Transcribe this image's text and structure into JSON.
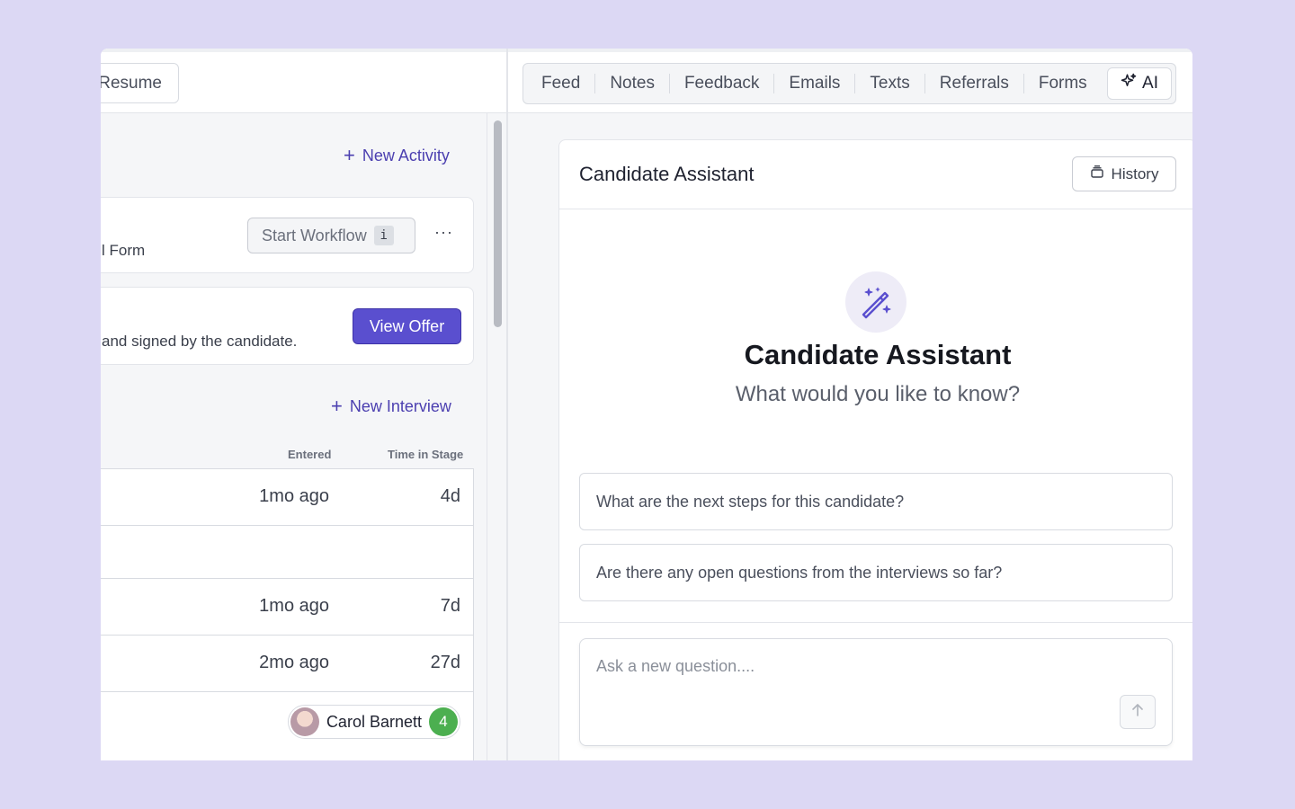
{
  "left": {
    "resume_label": "Resume",
    "new_activity_label": "New Activity",
    "workflow_card": {
      "text": "l Form",
      "start_workflow_label": "Start Workflow",
      "info_label": "i",
      "more_label": "···"
    },
    "offer_card": {
      "text": "and signed by the candidate.",
      "view_offer_label": "View Offer"
    },
    "new_interview_label": "New Interview",
    "table": {
      "col_entered": "Entered",
      "col_time_in_stage": "Time in Stage",
      "rows": [
        {
          "entered": "1mo ago",
          "time": "4d"
        },
        {
          "entered": "",
          "time": ""
        },
        {
          "entered": "1mo ago",
          "time": "7d"
        },
        {
          "entered": "2mo ago",
          "time": "27d"
        }
      ],
      "person": {
        "name": "Carol Barnett",
        "count": "4"
      }
    }
  },
  "right": {
    "tabs": [
      "Feed",
      "Notes",
      "Feedback",
      "Emails",
      "Texts",
      "Referrals",
      "Forms"
    ],
    "ai_tab_label": "AI",
    "assistant": {
      "title": "Candidate Assistant",
      "history_label": "History",
      "hero_title": "Candidate Assistant",
      "hero_subtitle": "What would you like to know?",
      "suggestions": [
        "What are the next steps for this candidate?",
        "Are there any open questions from the interviews so far?"
      ],
      "ask_placeholder": "Ask a new question...."
    }
  },
  "colors": {
    "background": "#dcd8f4",
    "accent": "#5a4fcf",
    "link": "#4b3fb0",
    "badge_green": "#4caf50"
  }
}
